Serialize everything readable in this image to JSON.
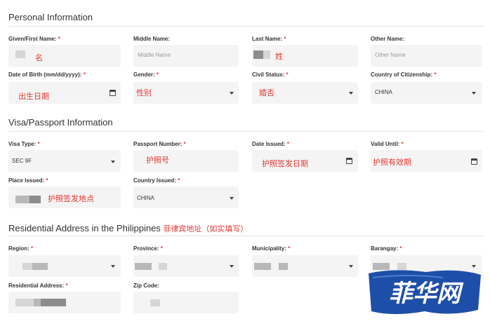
{
  "sections": {
    "personal": "Personal Information",
    "visa": "Visa/Passport Information",
    "residential": "Residential Address in the Philippines",
    "residential_note": "菲律宾地址（如实填写）"
  },
  "personal": {
    "first_name_label": "Given/First Name:",
    "first_name_note": "名",
    "middle_name_label": "Middle Name:",
    "middle_name_placeholder": "Middle Name",
    "last_name_label": "Last Name:",
    "last_name_note": "姓",
    "other_name_label": "Other Name:",
    "other_name_placeholder": "Other Name",
    "dob_label": "Date of Birth (mm/dd/yyyy):",
    "dob_note": "出生日期",
    "gender_label": "Gender:",
    "gender_note": "性别",
    "civil_status_label": "Civil Status:",
    "civil_status_note": "婚否",
    "citizenship_label": "Country of Citizenship:",
    "citizenship_value": "CHINA"
  },
  "visa": {
    "visa_type_label": "Visa Type:",
    "visa_type_value": "SEC 9F",
    "passport_number_label": "Passport Number:",
    "passport_number_note": "护照号",
    "date_issued_label": "Date Issued:",
    "date_issued_note": "护照签发日期",
    "valid_until_label": "Valid Until:",
    "valid_until_note": "护照有效期",
    "place_issued_label": "Place Issued:",
    "place_issued_note": "护照签发地点",
    "country_issued_label": "Country Issued:",
    "country_issued_value": "CHINA"
  },
  "address": {
    "region_label": "Region:",
    "province_label": "Province:",
    "municipality_label": "Municipality:",
    "barangay_label": "Barangay:",
    "residential_address_label": "Residential Address:",
    "zip_code_label": "Zip Code:"
  },
  "required_mark": "*",
  "watermark": "菲华网",
  "colors": {
    "annotation_red": "#e53935",
    "field_bg": "#f4f4f4",
    "logo_blue": "#1e4fa8"
  }
}
